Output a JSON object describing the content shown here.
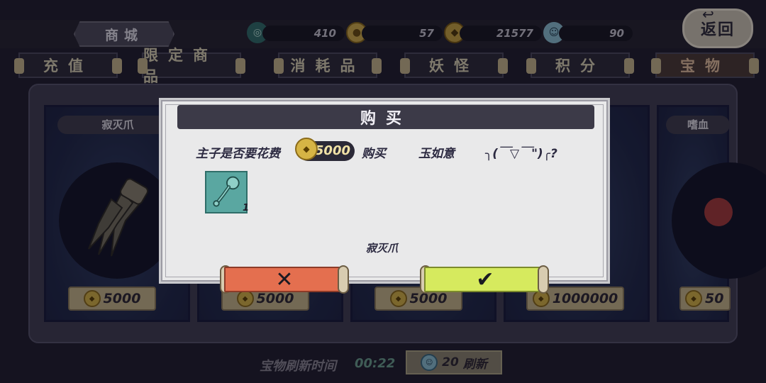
{
  "header": {
    "shop_title": "商城",
    "resources": [
      {
        "icon": "jade-swirl-icon",
        "value": "410"
      },
      {
        "icon": "gold-coin-icon",
        "value": "57"
      },
      {
        "icon": "copper-coin-icon",
        "value": "21577"
      },
      {
        "icon": "spirit-ghost-icon",
        "value": "90"
      }
    ],
    "back_label": "返回"
  },
  "tabs": [
    {
      "label": "充值",
      "active": false
    },
    {
      "label": "限定商品",
      "active": false
    },
    {
      "label": "消耗品",
      "active": false
    },
    {
      "label": "妖怪",
      "active": false
    },
    {
      "label": "积分",
      "active": false
    },
    {
      "label": "宝物",
      "active": true
    }
  ],
  "cards": [
    {
      "name": "寂灭爪",
      "price": "5000"
    },
    {
      "name": "",
      "price": "5000"
    },
    {
      "name": "",
      "price": "5000"
    },
    {
      "name": "",
      "price": "1000000"
    },
    {
      "name": "嗜血",
      "price": "50"
    }
  ],
  "footer": {
    "refresh_label": "宝物刷新时间",
    "refresh_time": "00:22",
    "refresh_cost": "20",
    "refresh_button_label": "刷新"
  },
  "dialog": {
    "title": "购买",
    "prompt_prefix": "主子是否要花费",
    "cost": "5000",
    "prompt_verb": "购买",
    "item_highlight": "玉如意",
    "emoticon": "╮(￣▽￣\")╭?",
    "item_count": "1",
    "item_name": "寂灭爪",
    "cancel_symbol": "✕",
    "confirm_symbol": "✔"
  },
  "colors": {
    "background": "#1e1c2c",
    "cancel": "#e46f4f",
    "confirm": "#d6ea5e",
    "card_blue": "#1e2748"
  }
}
